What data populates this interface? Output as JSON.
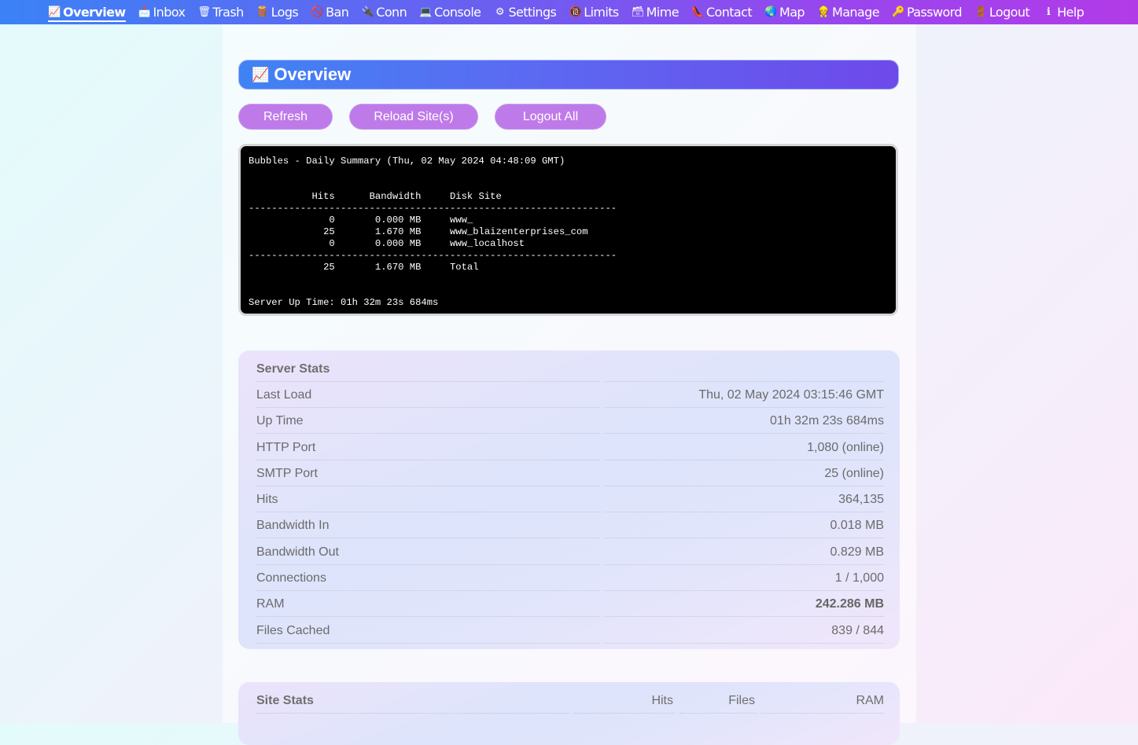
{
  "nav": {
    "items": [
      {
        "icon": "📈",
        "label": "Overview"
      },
      {
        "icon": "📩",
        "label": "Inbox"
      },
      {
        "icon": "🗑",
        "label": "Trash"
      },
      {
        "icon": "🪵",
        "label": "Logs"
      },
      {
        "icon": "🚫",
        "label": "Ban"
      },
      {
        "icon": "🔌",
        "label": "Conn"
      },
      {
        "icon": "💻",
        "label": "Console"
      },
      {
        "icon": "⚙",
        "label": "Settings"
      },
      {
        "icon": "🔞",
        "label": "Limits"
      },
      {
        "icon": "🗃",
        "label": "Mime"
      },
      {
        "icon": "👠",
        "label": "Contact"
      },
      {
        "icon": "🌏",
        "label": "Map"
      },
      {
        "icon": "👷",
        "label": "Manage"
      },
      {
        "icon": "🔑",
        "label": "Password"
      },
      {
        "icon": "🚪",
        "label": "Logout"
      },
      {
        "icon": "ℹ",
        "label": "Help"
      }
    ]
  },
  "page": {
    "title_icon": "📈",
    "title": "Overview"
  },
  "buttons": {
    "refresh": "Refresh",
    "reload": "Reload Site(s)",
    "logout_all": "Logout All"
  },
  "console": {
    "text": "Bubbles - Daily Summary (Thu, 02 May 2024 04:48:09 GMT)\n\n\n           Hits      Bandwidth     Disk Site\n----------------------------------------------------------------\n              0       0.000 MB     www_\n             25       1.670 MB     www_blaizenterprises_com\n              0       0.000 MB     www_localhost\n----------------------------------------------------------------\n             25       1.670 MB     Total\n\n\nServer Up Time: 01h 32m 23s 684ms"
  },
  "server_stats": {
    "heading": "Server Stats",
    "rows": [
      {
        "label": "Last Load",
        "value": "Thu, 02 May 2024 03:15:46 GMT"
      },
      {
        "label": "Up Time",
        "value": "01h 32m 23s 684ms"
      },
      {
        "label": "HTTP Port",
        "value": "1,080 (online)"
      },
      {
        "label": "SMTP Port",
        "value": "25 (online)"
      },
      {
        "label": "Hits",
        "value": "364,135"
      },
      {
        "label": "Bandwidth In",
        "value": "0.018 MB"
      },
      {
        "label": "Bandwidth Out",
        "value": "0.829 MB"
      },
      {
        "label": "Connections",
        "value": "1 / 1,000"
      },
      {
        "label": "RAM",
        "value": "242.286 MB"
      },
      {
        "label": "Files Cached",
        "value": "839 / 844"
      }
    ]
  },
  "site_stats": {
    "heading": "Site Stats",
    "col_hits": "Hits",
    "col_files": "Files",
    "col_ram": "RAM"
  }
}
